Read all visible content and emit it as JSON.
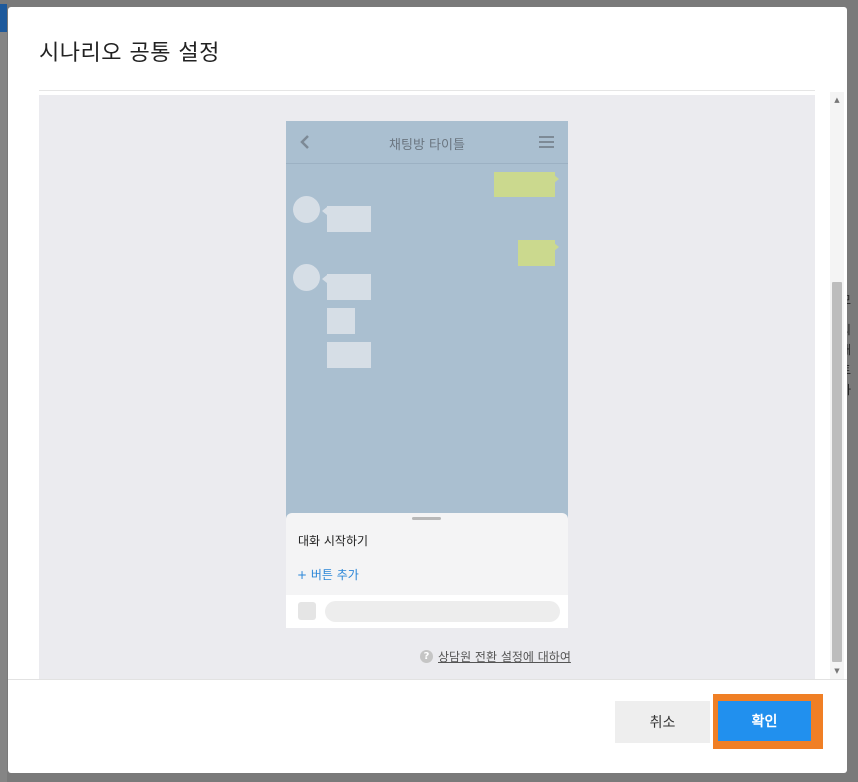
{
  "background": {
    "right_fragment_chars": [
      "모",
      "의 재",
      "트하",
      "인"
    ]
  },
  "modal": {
    "title": "시나리오 공통 설정"
  },
  "preview": {
    "header_title": "채팅방 타이틀",
    "sheet_title": "대화 시작하기",
    "add_button_label": "+ 버튼 추가"
  },
  "help": {
    "icon": "?",
    "link_text": "상담원 전환 설정에 대하여"
  },
  "footer": {
    "cancel_label": "취소",
    "confirm_label": "확인"
  },
  "colors": {
    "accent": "#2190ee",
    "highlight": "#f07f25",
    "chat_bg": "#aabfd0",
    "my_bubble": "#cbd98e",
    "other_bubble": "#d6dee6",
    "link": "#2a86d8"
  }
}
